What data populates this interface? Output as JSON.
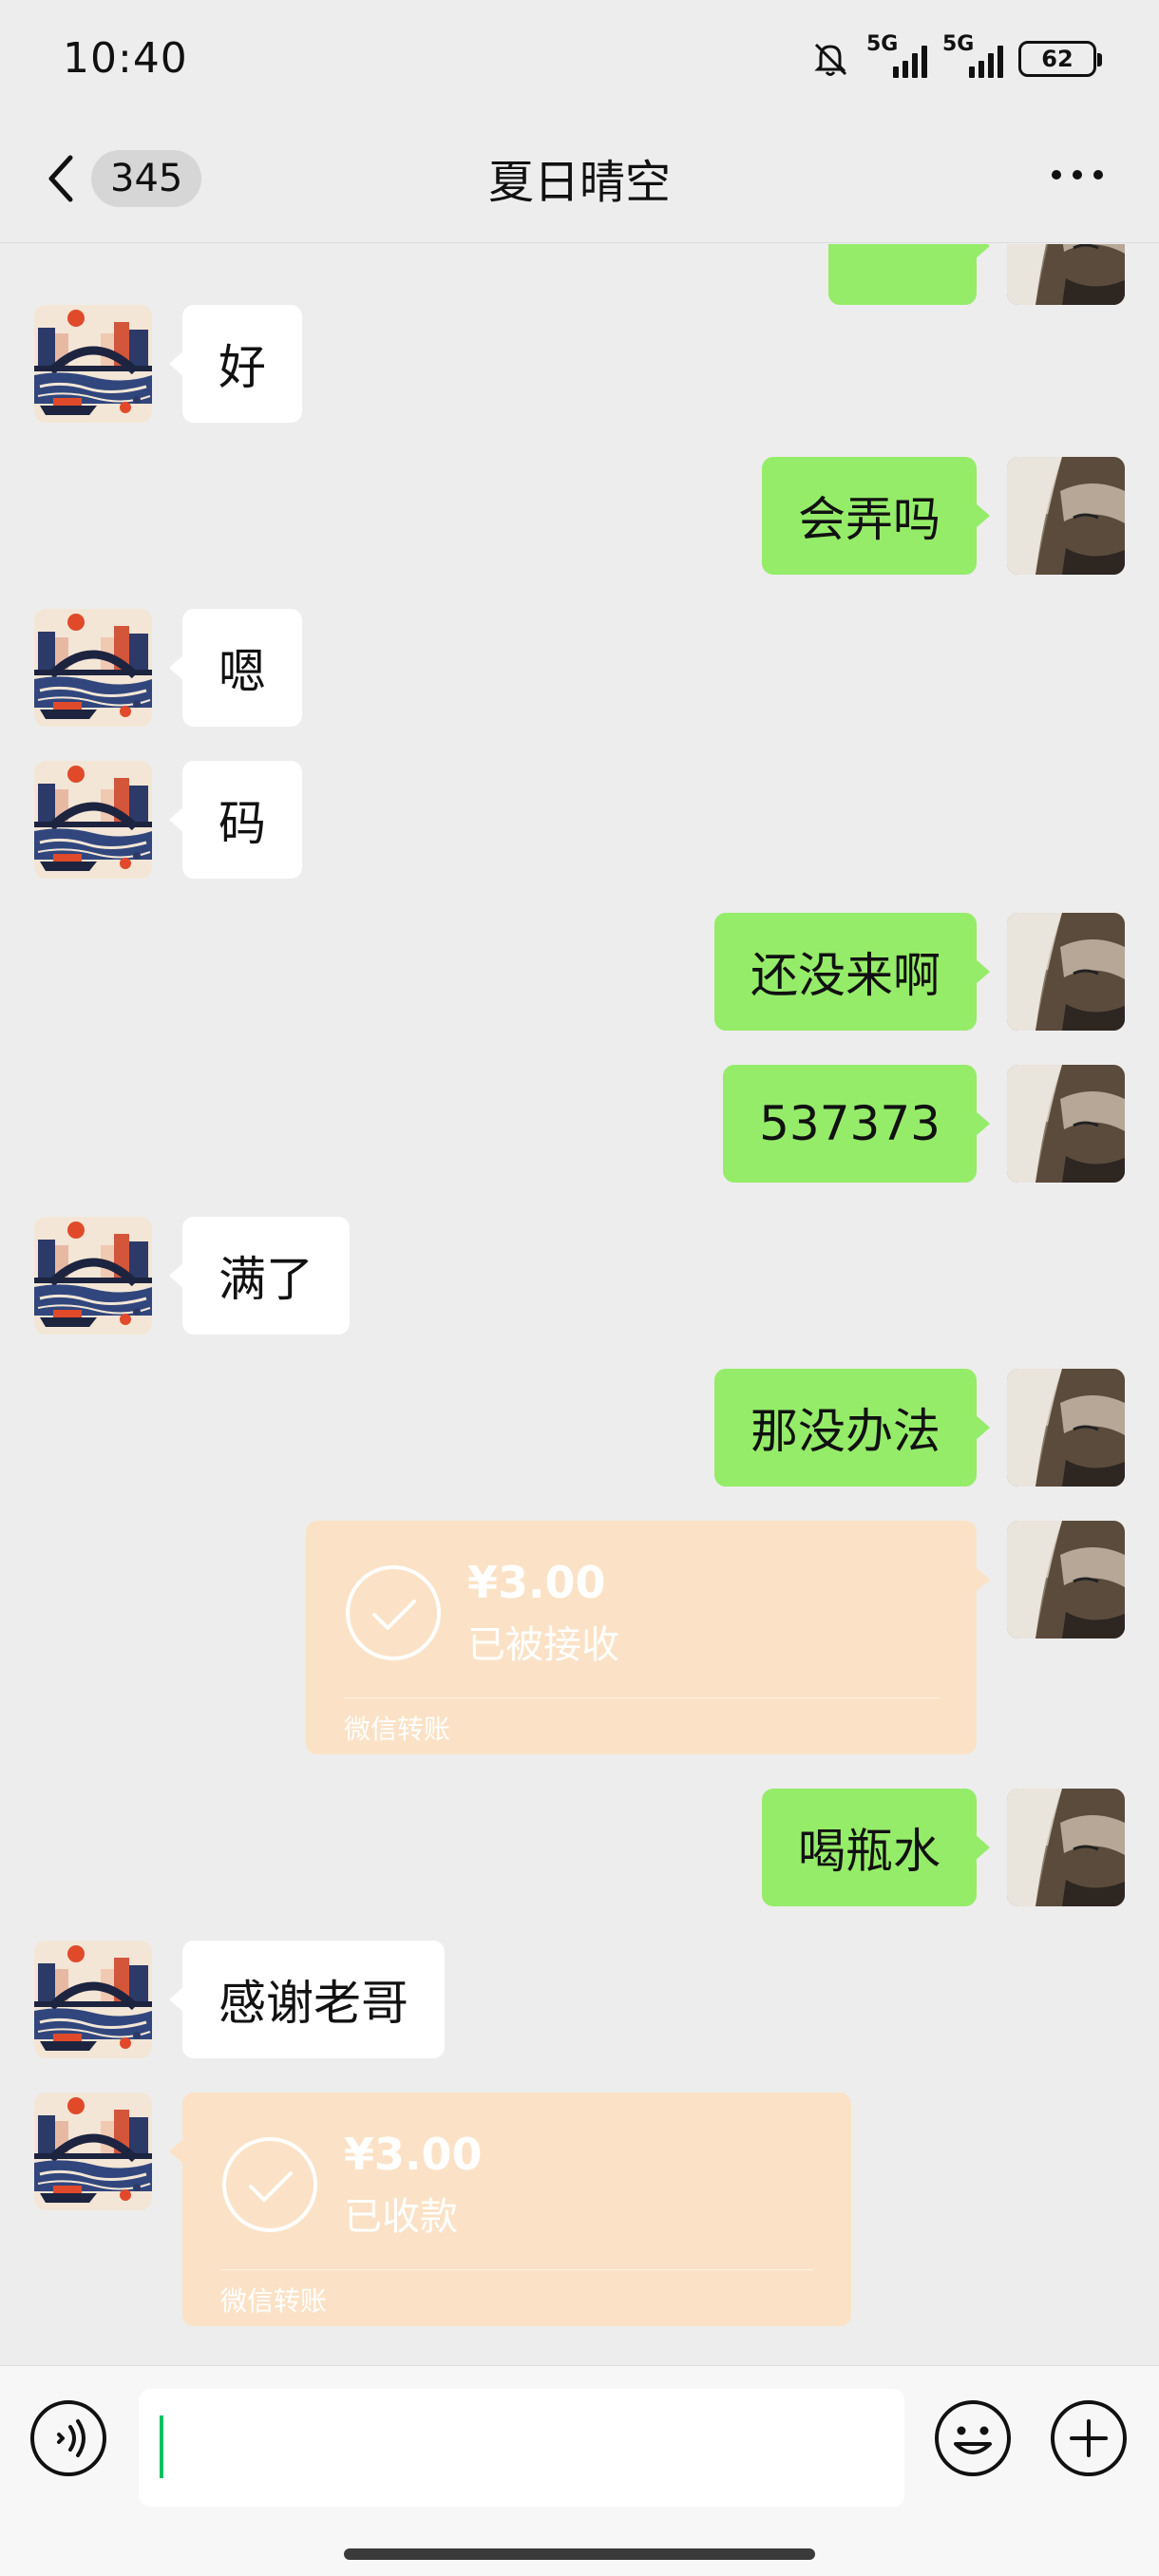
{
  "status": {
    "time": "10:40",
    "sim1": "5G",
    "sim2": "5G",
    "battery": "62",
    "icons": [
      "bell-muted-icon",
      "signal-icon",
      "battery-icon"
    ]
  },
  "header": {
    "back_icon": "chevron-left-icon",
    "unread_count": "345",
    "title": "夏日晴空",
    "more_icon": "more-dots-icon"
  },
  "messages": [
    {
      "side": "right",
      "type": "text",
      "text": ""
    },
    {
      "side": "left",
      "type": "text",
      "text": "好"
    },
    {
      "side": "right",
      "type": "text",
      "text": "会弄吗"
    },
    {
      "side": "left",
      "type": "text",
      "text": "嗯"
    },
    {
      "side": "left",
      "type": "text",
      "text": "码"
    },
    {
      "side": "right",
      "type": "text",
      "text": "还没来啊"
    },
    {
      "side": "right",
      "type": "text",
      "text": "537373"
    },
    {
      "side": "left",
      "type": "text",
      "text": "满了"
    },
    {
      "side": "right",
      "type": "text",
      "text": "那没办法"
    },
    {
      "side": "right",
      "type": "transfer",
      "amount": "¥3.00",
      "status": "已被接收",
      "label": "微信转账"
    },
    {
      "side": "right",
      "type": "text",
      "text": "喝瓶水"
    },
    {
      "side": "left",
      "type": "text",
      "text": "感谢老哥"
    },
    {
      "side": "left",
      "type": "transfer",
      "amount": "¥3.00",
      "status": "已收款",
      "label": "微信转账"
    }
  ],
  "input": {
    "value": "",
    "voice_icon": "voice-icon",
    "emoji_icon": "emoji-icon",
    "plus_icon": "plus-icon"
  },
  "colors": {
    "background": "#ededed",
    "outgoing_bubble": "#95ec69",
    "incoming_bubble": "#ffffff",
    "transfer_card": "#fbe2c6",
    "cursor": "#07c160"
  }
}
